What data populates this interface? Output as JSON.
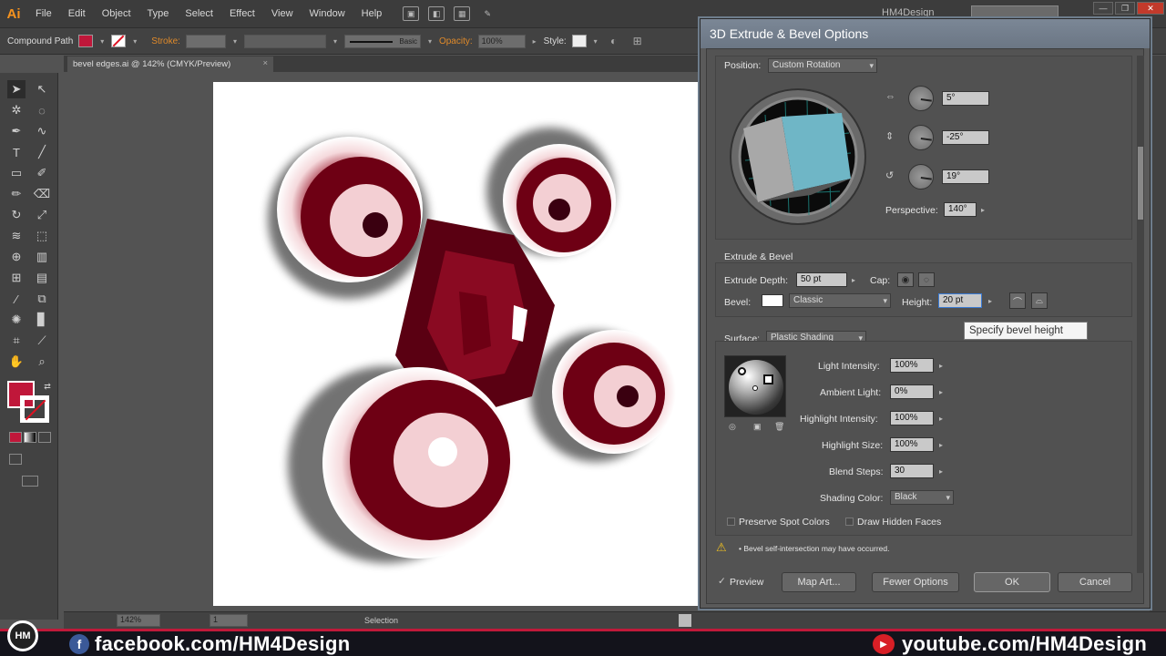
{
  "app": {
    "logo": "Ai",
    "menus": [
      "File",
      "Edit",
      "Object",
      "Type",
      "Select",
      "Effect",
      "View",
      "Window",
      "Help"
    ],
    "workspace": "HM4Design",
    "colors": {
      "accent_orange": "#f7931e",
      "fill_red": "#c0173a",
      "art_maroon": "#6e0014",
      "art_shadow": "#3a0010"
    }
  },
  "control_bar": {
    "object_type": "Compound Path",
    "stroke_label": "Stroke:",
    "stroke_style": "Basic",
    "opacity_label": "Opacity:",
    "opacity_value": "100%",
    "style_label": "Style:"
  },
  "document": {
    "tab_title": "bevel edges.ai @ 142% (CMYK/Preview)",
    "tab_close": "×"
  },
  "status_bar": {
    "zoom": "142%",
    "artboard": "1",
    "tool": "Selection"
  },
  "dialog": {
    "title": "3D Extrude & Bevel Options",
    "position_label": "Position:",
    "position_value": "Custom Rotation",
    "rotation": {
      "x": "5°",
      "y": "-25°",
      "z": "19°"
    },
    "perspective_label": "Perspective:",
    "perspective_value": "140°",
    "extrude_section": "Extrude & Bevel",
    "extrude_depth_label": "Extrude Depth:",
    "extrude_depth_value": "50 pt",
    "cap_label": "Cap:",
    "bevel_label": "Bevel:",
    "bevel_value": "Classic",
    "height_label": "Height:",
    "height_value": "20 pt",
    "tooltip": "Specify bevel height",
    "surface_label": "Surface:",
    "surface_value": "Plastic Shading",
    "light_intensity_label": "Light Intensity:",
    "light_intensity_value": "100%",
    "ambient_light_label": "Ambient Light:",
    "ambient_light_value": "0%",
    "highlight_intensity_label": "Highlight Intensity:",
    "highlight_intensity_value": "100%",
    "highlight_size_label": "Highlight Size:",
    "highlight_size_value": "100%",
    "blend_steps_label": "Blend Steps:",
    "blend_steps_value": "30",
    "shading_color_label": "Shading Color:",
    "shading_color_value": "Black",
    "preserve_spot_label": "Preserve Spot Colors",
    "draw_hidden_label": "Draw Hidden Faces",
    "warning": "• Bevel self-intersection may have occurred.",
    "preview_label": "Preview",
    "buttons": {
      "map_art": "Map Art...",
      "fewer_options": "Fewer Options",
      "ok": "OK",
      "cancel": "Cancel"
    }
  },
  "watermark": {
    "badge": "HM",
    "facebook_icon": "f",
    "facebook": "facebook.com/HM4Design",
    "youtube_icon": "▶",
    "youtube": "youtube.com/HM4Design"
  }
}
